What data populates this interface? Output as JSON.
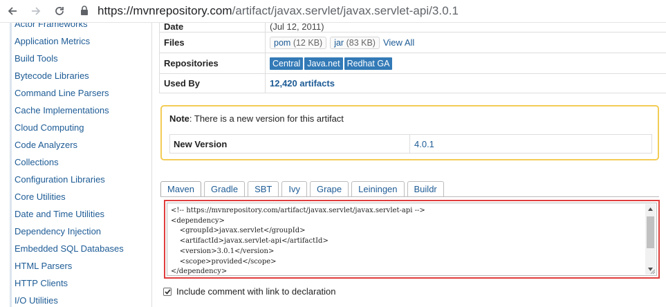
{
  "browser": {
    "url_host": "https://mvnrepository.com",
    "url_path": "/artifact/javax.servlet/javax.servlet-api/3.0.1"
  },
  "sidebar": {
    "items": [
      {
        "label": "Actor Frameworks"
      },
      {
        "label": "Application Metrics"
      },
      {
        "label": "Build Tools"
      },
      {
        "label": "Bytecode Libraries"
      },
      {
        "label": "Command Line Parsers"
      },
      {
        "label": "Cache Implementations"
      },
      {
        "label": "Cloud Computing"
      },
      {
        "label": "Code Analyzers"
      },
      {
        "label": "Collections"
      },
      {
        "label": "Configuration Libraries"
      },
      {
        "label": "Core Utilities"
      },
      {
        "label": "Date and Time Utilities"
      },
      {
        "label": "Dependency Injection"
      },
      {
        "label": "Embedded SQL Databases"
      },
      {
        "label": "HTML Parsers"
      },
      {
        "label": "HTTP Clients"
      },
      {
        "label": "I/O Utilities"
      }
    ]
  },
  "info": {
    "date_label": "Date",
    "date_value": "(Jul 12, 2011)",
    "files_label": "Files",
    "files": [
      {
        "name": "pom",
        "size": "(12 KB)"
      },
      {
        "name": "jar",
        "size": "(83 KB)"
      }
    ],
    "view_all": "View All",
    "repos_label": "Repositories",
    "repos": [
      "Central",
      "Java.net",
      "Redhat GA"
    ],
    "used_by_label": "Used By",
    "used_by_value": "12,420 artifacts"
  },
  "note": {
    "bold": "Note",
    "text": ": There is a new version for this artifact",
    "new_version_label": "New Version",
    "new_version_value": "4.0.1"
  },
  "tabs": [
    "Maven",
    "Gradle",
    "SBT",
    "Ivy",
    "Grape",
    "Leiningen",
    "Buildr"
  ],
  "active_tab": "Maven",
  "code": {
    "lines": [
      "<!-- https://mvnrepository.com/artifact/javax.servlet/javax.servlet-api -->",
      "<dependency>",
      "    <groupId>javax.servlet</groupId>",
      "    <artifactId>javax.servlet-api</artifactId>",
      "    <version>3.0.1</version>",
      "    <scope>provided</scope>",
      "</dependency>"
    ]
  },
  "include_comment": {
    "label": "Include comment with link to declaration",
    "checked": true
  },
  "colors": {
    "link": "#1d5b95",
    "badge": "#337ab7",
    "note_border": "#f3cc55",
    "highlight_border": "#e03c3c"
  }
}
